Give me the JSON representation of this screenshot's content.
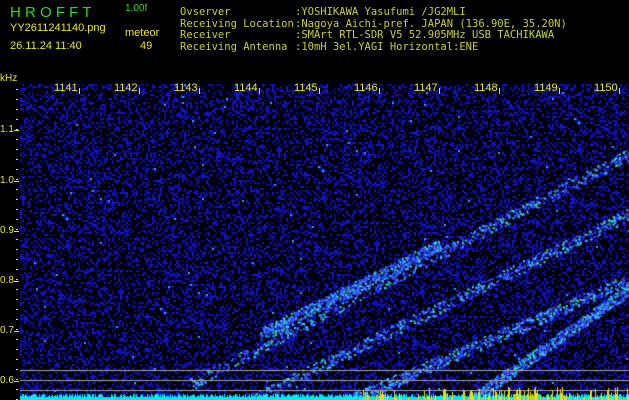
{
  "header": {
    "app_title": "H R O F F T",
    "version": "1.00f",
    "filename": "YY2611241140.png",
    "datetime": "26.11.24 11:40",
    "meteor_label": "meteor",
    "meteor_count": "49"
  },
  "info": [
    {
      "label": "Ovserver",
      "value": ":YOSHIKAWA Yasufumi /JG2MLI"
    },
    {
      "label": "Receiving Location",
      "value": ":Nagoya Aichi-pref. JAPAN (136.90E, 35.20N)"
    },
    {
      "label": "Receiver",
      "value": ":SMArt RTL-SDR V5 52.905MHz USB TACHIKAWA"
    },
    {
      "label": "Receiving Antenna",
      "value": ":10mH 3el.YAGI Horizontal:ENE"
    }
  ],
  "axes": {
    "y_unit": "kHz",
    "y_labels": [
      "1.1",
      "1.0",
      "0.9",
      "0.8",
      "0.7",
      "0.6"
    ],
    "x_labels": [
      "1141",
      "1142",
      "1143",
      "1144",
      "1145",
      "1146",
      "1147",
      "1148",
      "1149",
      "1150"
    ]
  },
  "colors": {
    "background": "#000000",
    "noise": "#1a1acc",
    "text": "#e8e820",
    "title": "#22dd22",
    "floor": "#00e8f0"
  }
}
